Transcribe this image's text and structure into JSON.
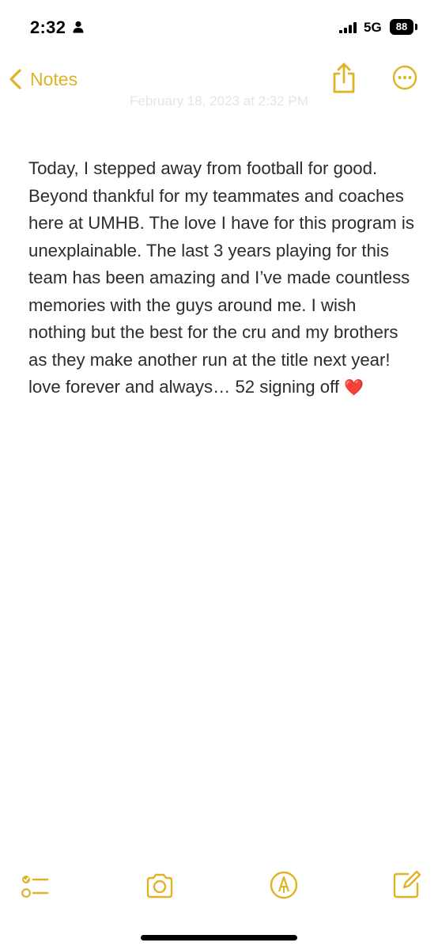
{
  "status_bar": {
    "time": "2:32",
    "person_icon": "person-fill-icon",
    "signal_icon": "cellular-signal-icon",
    "network": "5G",
    "battery": "88"
  },
  "nav": {
    "back_label": "Notes",
    "back_icon": "chevron-left-icon",
    "share_icon": "share-icon",
    "more_icon": "ellipsis-circle-icon",
    "accent_color": "#e0b225"
  },
  "note": {
    "date": "February 18, 2023 at 2:32 PM",
    "text": "Today, I stepped away from football for good. Beyond thankful for my teammates and coaches here at UMHB. The love I have for this program is unexplainable. The last 3 years playing for this team has been amazing and I’ve made countless memories with the guys around me. I wish nothing but the best for the cru and my brothers as they make another run at the title next year! love forever and always… 52 signing off",
    "emoji": "❤️"
  },
  "toolbar": {
    "checklist_icon": "checklist-icon",
    "camera_icon": "camera-icon",
    "markup_icon": "markup-pen-icon",
    "compose_icon": "compose-icon"
  }
}
